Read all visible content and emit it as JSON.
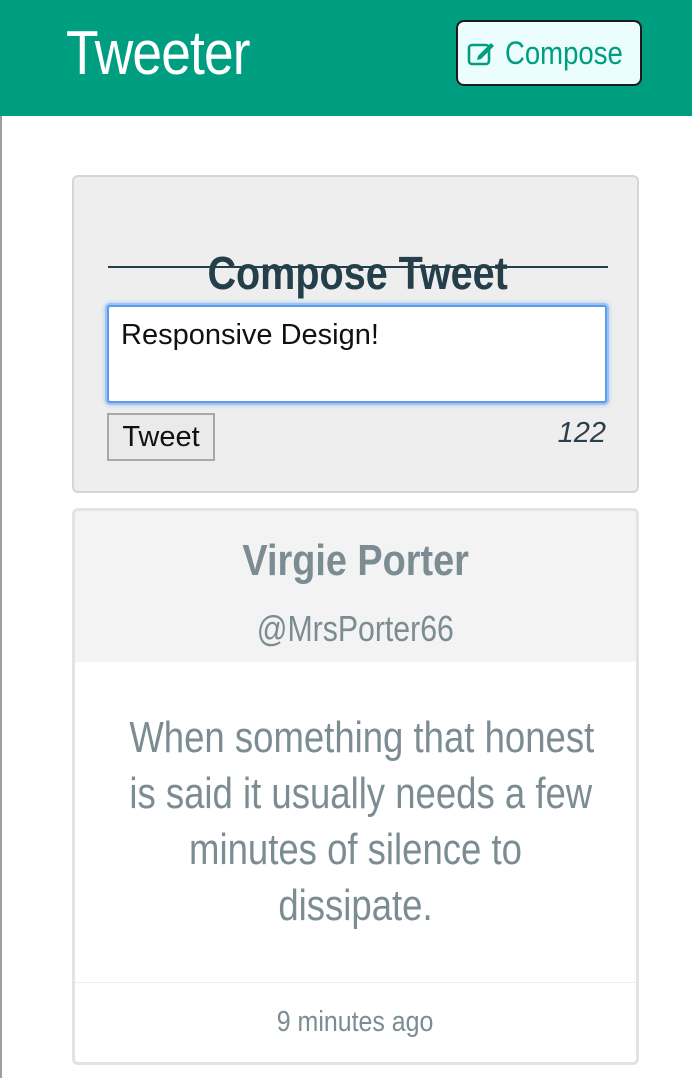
{
  "navbar": {
    "brand": "Tweeter",
    "compose_button": {
      "label": "Compose",
      "icon": "edit-icon"
    },
    "background": "#009e81"
  },
  "compose": {
    "title": "Compose Tweet",
    "input_value": "Responsive Design!",
    "submit_label": "Tweet",
    "char_counter": "122"
  },
  "tweets": [
    {
      "name": "Virgie Porter",
      "handle": "@MrsPorter66",
      "text_lines": [
        "When something that honest",
        "is said it usually needs a few",
        "minutes of silence to",
        "dissipate."
      ],
      "time": "9 minutes ago"
    }
  ],
  "colors": {
    "accent": "#009e81",
    "heading": "#243f4a",
    "muted_text": "#7b8c92",
    "focus_ring": "#5d9ced"
  }
}
